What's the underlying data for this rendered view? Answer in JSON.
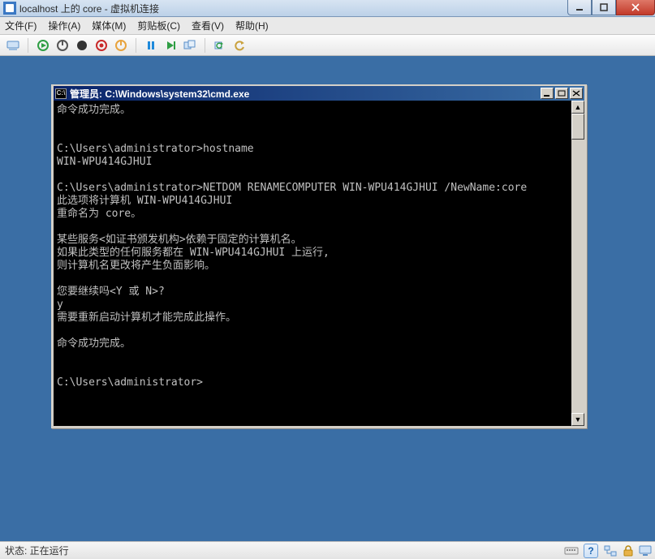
{
  "outer": {
    "title": "localhost 上的 core - 虚拟机连接"
  },
  "menu": {
    "file": "文件(F)",
    "action": "操作(A)",
    "media": "媒体(M)",
    "clipboard": "剪贴板(C)",
    "view": "查看(V)",
    "help": "帮助(H)"
  },
  "cmd": {
    "title": "管理员: C:\\Windows\\system32\\cmd.exe",
    "body": "命令成功完成。\n\n\nC:\\Users\\administrator>hostname\nWIN-WPU414GJHUI\n\nC:\\Users\\administrator>NETDOM RENAMECOMPUTER WIN-WPU414GJHUI /NewName:core\n此选项将计算机 WIN-WPU414GJHUI\n重命名为 core。\n\n某些服务<如证书颁发机构>依赖于固定的计算机名。\n如果此类型的任何服务都在 WIN-WPU414GJHUI 上运行,\n则计算机名更改将产生负面影响。\n\n您要继续吗<Y 或 N>?\ny\n需要重新启动计算机才能完成此操作。\n\n命令成功完成。\n\n\nC:\\Users\\administrator>"
  },
  "status": {
    "text": "状态: 正在运行"
  }
}
